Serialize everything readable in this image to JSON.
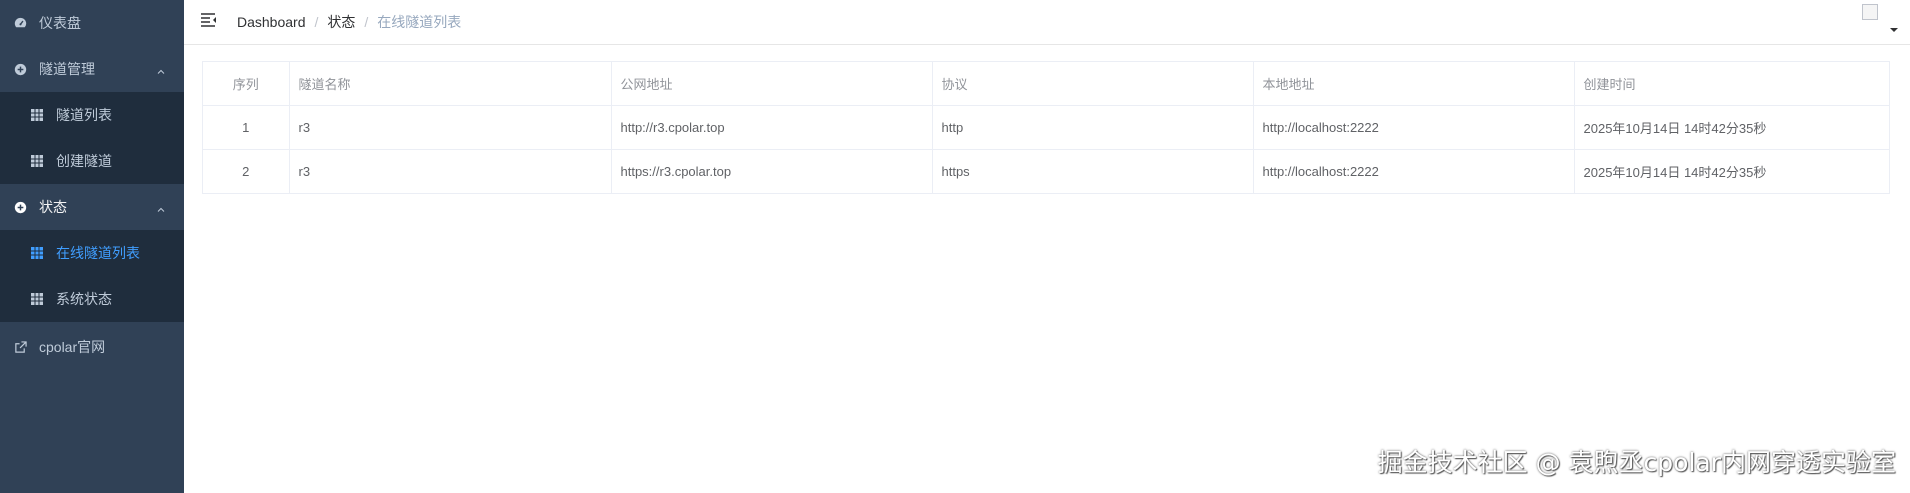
{
  "sidebar": {
    "items": [
      {
        "label": "仪表盘",
        "icon": "dashboard-icon"
      },
      {
        "label": "隧道管理",
        "icon": "plus-circle-icon"
      },
      {
        "label": "隧道列表",
        "icon": "grid-icon"
      },
      {
        "label": "创建隧道",
        "icon": "grid-icon"
      },
      {
        "label": "状态",
        "icon": "plus-circle-icon"
      },
      {
        "label": "在线隧道列表",
        "icon": "grid-icon",
        "active": true
      },
      {
        "label": "系统状态",
        "icon": "grid-icon"
      },
      {
        "label": "cpolar官网",
        "icon": "external-link-icon"
      }
    ]
  },
  "breadcrumb": {
    "items": [
      "Dashboard",
      "状态",
      "在线隧道列表"
    ],
    "separator": "/"
  },
  "table": {
    "columns": [
      "序列",
      "隧道名称",
      "公网地址",
      "协议",
      "本地地址",
      "创建时间"
    ],
    "rows": [
      [
        "1",
        "r3",
        "http://r3.cpolar.top",
        "http",
        "http://localhost:2222",
        "2025年10月14日 14时42分35秒"
      ],
      [
        "2",
        "r3",
        "https://r3.cpolar.top",
        "https",
        "http://localhost:2222",
        "2025年10月14日 14时42分35秒"
      ]
    ]
  },
  "watermark": "掘金技术社区 @ 袁煦丞cpolar内网穿透实验室",
  "colors": {
    "sidebar_bg": "#304156",
    "submenu_bg": "#1f2d3d",
    "active": "#409eff",
    "menu_text": "#bfcbd9"
  }
}
